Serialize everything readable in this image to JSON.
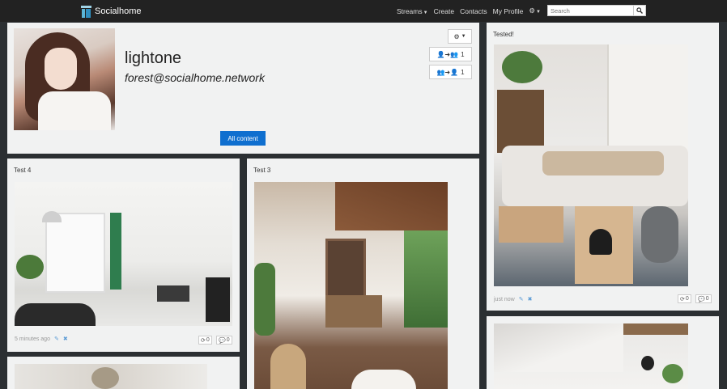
{
  "navbar": {
    "brand": "Socialhome",
    "items": [
      {
        "label": "Streams",
        "dropdown": true
      },
      {
        "label": "Create",
        "dropdown": false
      },
      {
        "label": "Contacts",
        "dropdown": false
      },
      {
        "label": "My Profile",
        "dropdown": false
      }
    ],
    "search_placeholder": "Search"
  },
  "profile": {
    "name": "lightone",
    "handle": "forest@socialhome.network",
    "following_count": "1",
    "followers_count": "1",
    "all_content_label": "All content"
  },
  "posts": [
    {
      "title": "Test 4",
      "timestamp": "5 minutes ago",
      "shares": "0",
      "replies": "0"
    },
    {
      "title": "Test 3"
    },
    {
      "title": "Tested!",
      "timestamp": "just now",
      "shares": "0",
      "replies": "0"
    }
  ],
  "colors": {
    "navbar": "#222222",
    "page": "#2b2f32",
    "card": "#f1f2f2",
    "accent": "#0f6fcf"
  }
}
